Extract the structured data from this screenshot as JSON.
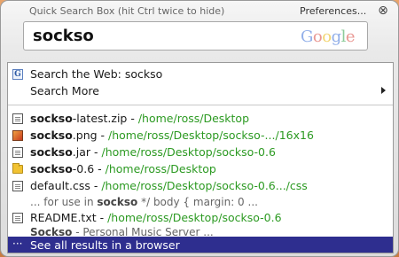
{
  "window": {
    "title": "Quick Search Box (hit Ctrl twice to hide)",
    "preferences_label": "Preferences...",
    "close_glyph": "⊗"
  },
  "search": {
    "query": "sockso",
    "logo_letters": [
      "G",
      "o",
      "o",
      "g",
      "l",
      "e"
    ]
  },
  "web_rows": [
    {
      "icon": "google-icon",
      "label": "Search the Web: sockso"
    },
    {
      "icon": "",
      "label": "Search More",
      "submenu": true
    }
  ],
  "results": [
    {
      "icon": "document-icon",
      "bold": "sockso",
      "name_rest": "-latest.zip",
      "sep": " - ",
      "path": "/home/ross/Desktop"
    },
    {
      "icon": "image-file-icon",
      "bold": "sockso",
      "name_rest": ".png",
      "sep": " - ",
      "path": "/home/ross/Desktop/sockso-.../16x16"
    },
    {
      "icon": "document-icon",
      "bold": "sockso",
      "name_rest": ".jar",
      "sep": " - ",
      "path": "/home/ross/Desktop/sockso-0.6"
    },
    {
      "icon": "folder-icon",
      "bold": "sockso",
      "name_rest": "-0.6",
      "sep": " - ",
      "path": "/home/ross/Desktop"
    },
    {
      "icon": "document-icon",
      "bold": "",
      "name_rest": "default.css",
      "sep": " - ",
      "path": "/home/ross/Desktop/sockso-0.6.../css",
      "snippet": {
        "pre": "... for use in ",
        "bold": "sockso",
        "post": " */ body { margin: 0 ..."
      }
    },
    {
      "icon": "document-icon",
      "bold": "",
      "name_rest": "README.txt",
      "sep": " - ",
      "path": "/home/ross/Desktop/sockso-0.6",
      "snippet": {
        "pre": "",
        "bold": "Sockso",
        "post": " - Personal Music Server ..."
      }
    }
  ],
  "footer": {
    "dots": "···",
    "label": "See all results in a browser"
  },
  "colors": {
    "path_green": "#2c9a22",
    "selection": "#2e2e8f",
    "desktop_orange": "#d98d50"
  }
}
